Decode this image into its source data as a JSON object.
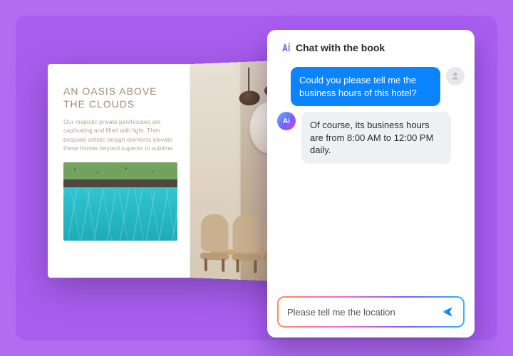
{
  "book": {
    "left_page": {
      "heading": "AN OASIS ABOVE THE CLOUDS",
      "body": "Our majestic private penthouses are captivating and filled with light. Their bespoke artistic design elements elevate these homes beyond superior to sublime."
    }
  },
  "chat": {
    "title": "Chat with the book",
    "messages": [
      {
        "role": "user",
        "text": "Could you please tell me the business hours of this hotel?"
      },
      {
        "role": "bot",
        "text": "Of course, its business hours are from 8:00 AM to 12:00 PM daily."
      }
    ],
    "input_value": "Please tell me the location",
    "ai_badge": "Ai"
  }
}
